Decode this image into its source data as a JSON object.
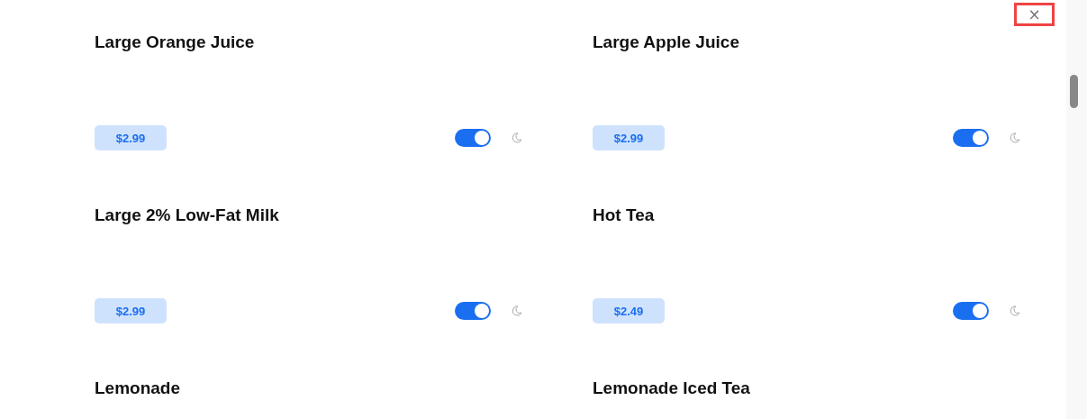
{
  "close_button": {
    "label": "×"
  },
  "products": [
    {
      "name": "Large Orange Juice",
      "price": "$2.99",
      "on": true
    },
    {
      "name": "Large Apple Juice",
      "price": "$2.99",
      "on": true
    },
    {
      "name": "Large 2% Low-Fat Milk",
      "price": "$2.99",
      "on": true
    },
    {
      "name": "Hot Tea",
      "price": "$2.49",
      "on": true
    },
    {
      "name": "Lemonade"
    },
    {
      "name": "Lemonade Iced Tea"
    }
  ]
}
